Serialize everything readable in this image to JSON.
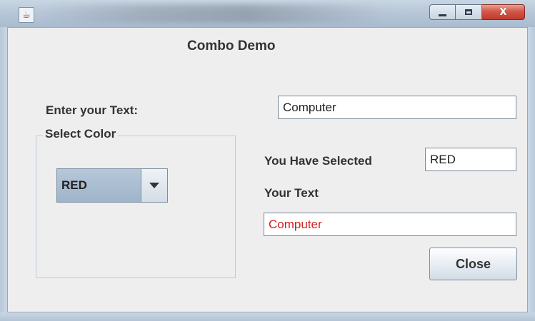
{
  "window": {
    "title": "",
    "icon": "java-cup-icon",
    "controls": {
      "minimize": "minimize",
      "maximize": "maximize",
      "close": "X"
    }
  },
  "heading": "Combo Demo",
  "enter_text": {
    "label": "Enter your Text:",
    "value": "Computer"
  },
  "color_group": {
    "title": "Select Color",
    "combo": {
      "selected": "RED"
    }
  },
  "you_selected": {
    "label": "You Have Selected",
    "value": "RED"
  },
  "your_text": {
    "label": "Your Text",
    "value": "Computer",
    "color": "#cc2222"
  },
  "close_button": {
    "label": "Close"
  }
}
